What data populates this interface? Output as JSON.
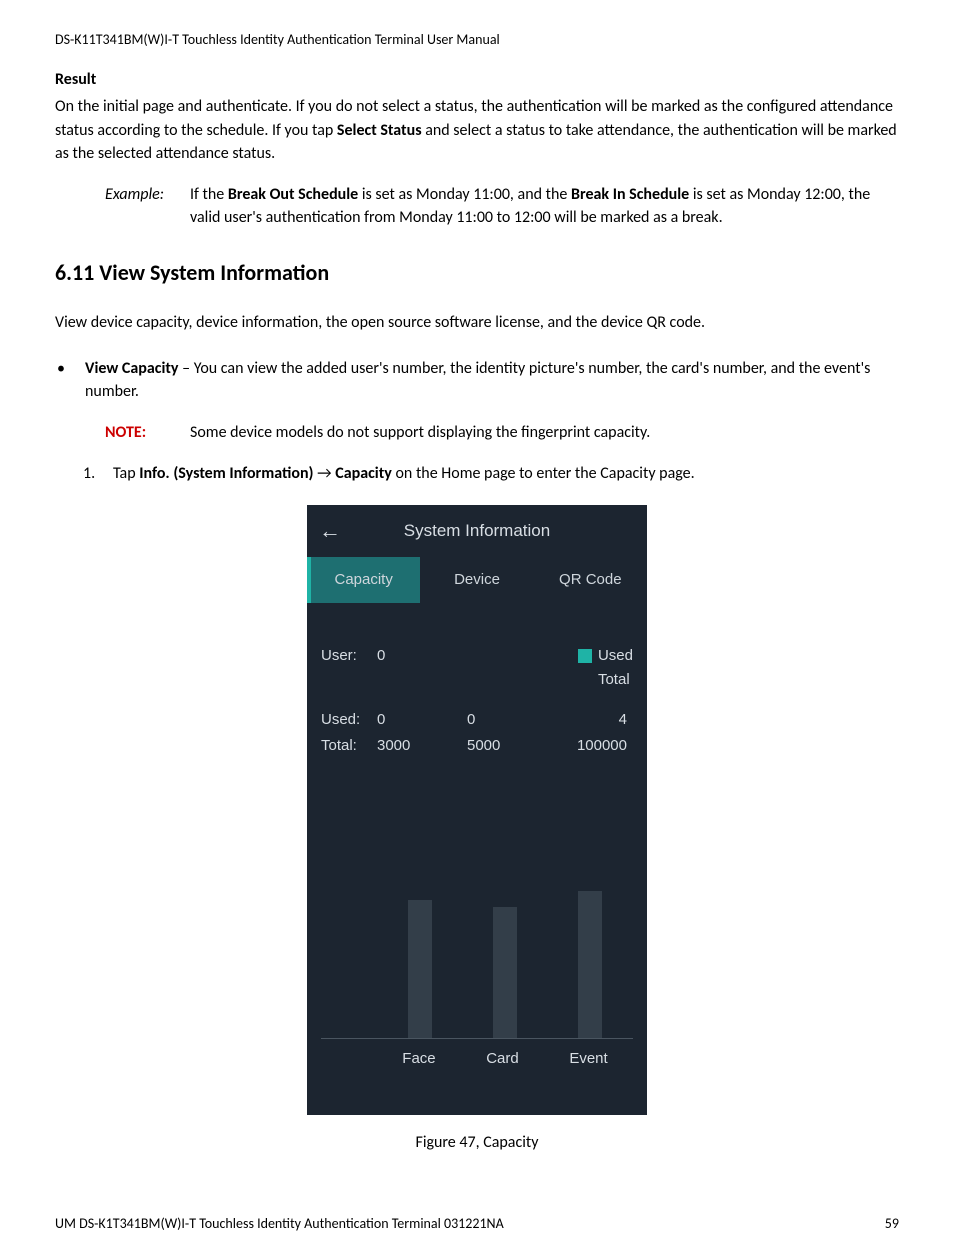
{
  "header": "DS-K11T341BM(W)I-T Touchless Identity Authentication Terminal User Manual",
  "result": {
    "heading": "Result",
    "p1a": "On the initial page and authenticate. If you do not select a status, the authentication will be marked as the configured attendance status according to the schedule. If you tap ",
    "p1b": "Select Status",
    "p1c": " and select a status to take attendance, the authentication will be marked as the selected attendance status."
  },
  "example": {
    "label": "Example:",
    "t1": "If the ",
    "t2": "Break Out Schedule",
    "t3": " is set as Monday 11:00, and the ",
    "t4": "Break In Schedule",
    "t5": " is set as Monday 12:00, the valid user's authentication from Monday 11:00 to 12:00 will be marked as a break."
  },
  "section": {
    "heading": "6.11 View System Information",
    "intro": "View device capacity, device information, the open source software license, and the device QR code."
  },
  "bullet": {
    "b1": "View Capacity",
    "b2": " – You can view the added user's number, the identity picture's number, the card's number, and the event's number."
  },
  "note": {
    "label": "NOTE:",
    "text": "Some device models do not support displaying the fingerprint capacity."
  },
  "step": {
    "num": "1.",
    "s1": "Tap ",
    "s2": "Info. (System Information)",
    "s3": " → ",
    "s4": "Capacity",
    "s5": " on the Home page to enter the Capacity page."
  },
  "device": {
    "title": "System Information",
    "tabs": {
      "capacity": "Capacity",
      "device": "Device",
      "qr": "QR Code"
    },
    "userLabel": "User:",
    "userValue": "0",
    "legendUsed": "Used",
    "legendTotal": "Total",
    "usedLabel": "Used:",
    "totalLabel": "Total:",
    "cols": {
      "used": {
        "a": "0",
        "b": "0",
        "c": "4"
      },
      "total": {
        "a": "3000",
        "b": "5000",
        "c": "100000"
      }
    },
    "axis": {
      "face": "Face",
      "card": "Card",
      "event": "Event"
    }
  },
  "figureCaption": "Figure 47, Capacity",
  "footer": {
    "left": "UM DS-K1T341BM(W)I-T Touchless Identity Authentication Terminal 031221NA",
    "right": "59"
  }
}
